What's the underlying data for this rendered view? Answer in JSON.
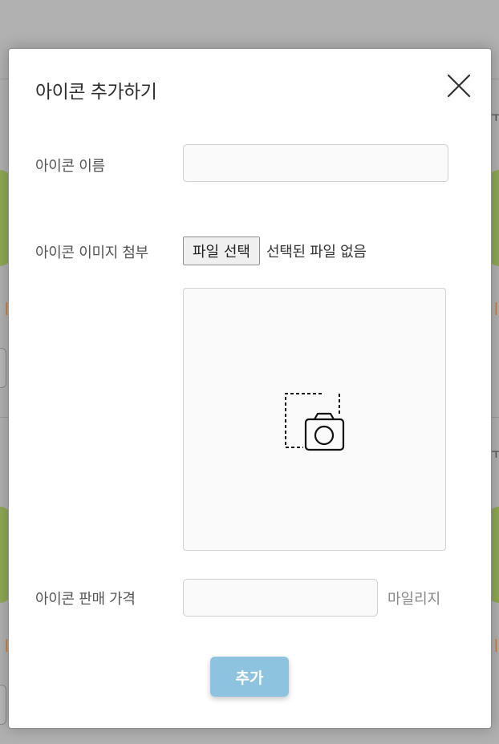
{
  "modal": {
    "title": "아이콘 추가하기",
    "close_icon": "close-icon"
  },
  "form": {
    "name_label": "아이콘 이름",
    "name_value": "",
    "image_label": "아이콘 이미지 첨부",
    "file_button_label": "파일 선택",
    "file_status": "선택된 파일 없음",
    "preview_icon": "camera-placeholder-icon",
    "price_label": "아이콘 판매 가격",
    "price_value": "",
    "price_unit": "마일리지"
  },
  "actions": {
    "submit_label": "추가"
  },
  "colors": {
    "overlay": "#b1b1b1",
    "submit_button": "#8ec3e0",
    "background_accent_orange": "#c9793a",
    "background_accent_green": "#88a844"
  }
}
